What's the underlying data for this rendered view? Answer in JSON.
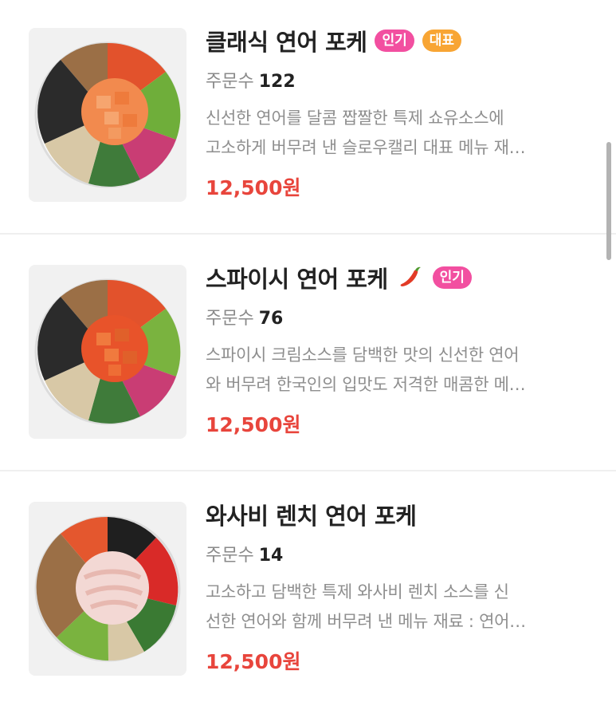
{
  "menu": {
    "items": [
      {
        "title": "클래식 연어 포케",
        "badges": [
          "인기",
          "대표"
        ],
        "orders_label": "주문수",
        "orders_count": "122",
        "desc_line1": "신선한 연어를 달콤 짭짤한 특제 쇼유소스에",
        "desc_line2": "고소하게 버무려 낸 슬로우캘리 대표 메뉴 재…",
        "price": "12,500원"
      },
      {
        "title": "스파이시 연어 포케",
        "icon": "chili-pepper-icon",
        "badges": [
          "인기"
        ],
        "orders_label": "주문수",
        "orders_count": "76",
        "desc_line1": "스파이시 크림소스를 담백한 맛의 신선한 연어",
        "desc_line2": "와 버무려 한국인의 입맛도 저격한 매콤한 메…",
        "price": "12,500원"
      },
      {
        "title": "와사비 렌치 연어 포케",
        "badges": [],
        "orders_label": "주문수",
        "orders_count": "14",
        "desc_line1": "고소하고 담백한 특제 와사비 렌치 소스를 신",
        "desc_line2": "선한 연어와 함께 버무려 낸 메뉴 재료 : 연어…",
        "price": "12,500원"
      }
    ]
  },
  "colors": {
    "badge_popular": "#f24fa0",
    "badge_signature": "#f8a534",
    "price": "#e8453c"
  }
}
